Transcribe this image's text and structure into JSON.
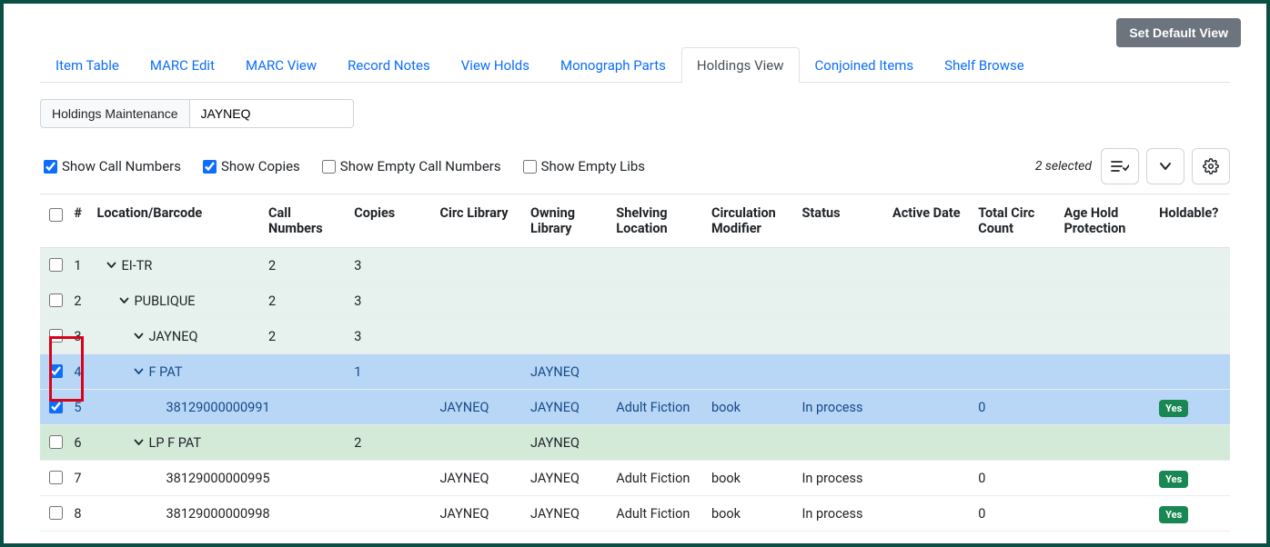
{
  "set_default_view": "Set Default View",
  "tabs": [
    {
      "label": "Item Table",
      "active": false
    },
    {
      "label": "MARC Edit",
      "active": false
    },
    {
      "label": "MARC View",
      "active": false
    },
    {
      "label": "Record Notes",
      "active": false
    },
    {
      "label": "View Holds",
      "active": false
    },
    {
      "label": "Monograph Parts",
      "active": false
    },
    {
      "label": "Holdings View",
      "active": true
    },
    {
      "label": "Conjoined Items",
      "active": false
    },
    {
      "label": "Shelf Browse",
      "active": false
    }
  ],
  "holdings_maintenance": "Holdings Maintenance",
  "location_value": "JAYNEQ",
  "filters": {
    "show_call_numbers": {
      "label": "Show Call Numbers",
      "checked": true
    },
    "show_copies": {
      "label": "Show Copies",
      "checked": true
    },
    "show_empty_call_numbers": {
      "label": "Show Empty Call Numbers",
      "checked": false
    },
    "show_empty_libs": {
      "label": "Show Empty Libs",
      "checked": false
    }
  },
  "selected_text": "2 selected",
  "columns": {
    "num": "#",
    "location": "Location/Barcode",
    "call_numbers": "Call Numbers",
    "copies": "Copies",
    "circ_library": "Circ Library",
    "owning_library": "Owning Library",
    "shelving_location": "Shelving Location",
    "circ_modifier": "Circulation Modifier",
    "status": "Status",
    "active_date": "Active Date",
    "total_circ": "Total Circ Count",
    "age_hold": "Age Hold Protection",
    "holdable": "Holdable?"
  },
  "rows": [
    {
      "n": "1",
      "type": "lib",
      "indent": 1,
      "loc": "EI-TR",
      "call_numbers": "2",
      "copies": "3",
      "expand": true,
      "checked": false
    },
    {
      "n": "2",
      "type": "lib",
      "indent": 2,
      "loc": "PUBLIQUE",
      "call_numbers": "2",
      "copies": "3",
      "expand": true,
      "checked": false
    },
    {
      "n": "3",
      "type": "lib",
      "indent": 3,
      "loc": "JAYNEQ",
      "call_numbers": "2",
      "copies": "3",
      "expand": true,
      "checked": false
    },
    {
      "n": "4",
      "type": "cn",
      "indent": 3,
      "loc": "F PAT",
      "copies": "1",
      "own": "JAYNEQ",
      "expand": true,
      "checked": true,
      "selected": true
    },
    {
      "n": "5",
      "type": "item",
      "indent": 4,
      "loc": "38129000000991",
      "circ": "JAYNEQ",
      "own": "JAYNEQ",
      "shelv": "Adult Fiction",
      "mod": "book",
      "status": "In process",
      "tot": "0",
      "holdable": "Yes",
      "checked": true,
      "selected": true
    },
    {
      "n": "6",
      "type": "cn",
      "indent": 3,
      "loc": "LP F PAT",
      "copies": "2",
      "own": "JAYNEQ",
      "expand": true,
      "checked": false,
      "green": true
    },
    {
      "n": "7",
      "type": "item",
      "indent": 4,
      "loc": "38129000000995",
      "circ": "JAYNEQ",
      "own": "JAYNEQ",
      "shelv": "Adult Fiction",
      "mod": "book",
      "status": "In process",
      "tot": "0",
      "holdable": "Yes",
      "checked": false
    },
    {
      "n": "8",
      "type": "item",
      "indent": 4,
      "loc": "38129000000998",
      "circ": "JAYNEQ",
      "own": "JAYNEQ",
      "shelv": "Adult Fiction",
      "mod": "book",
      "status": "In process",
      "tot": "0",
      "holdable": "Yes",
      "checked": false
    }
  ]
}
